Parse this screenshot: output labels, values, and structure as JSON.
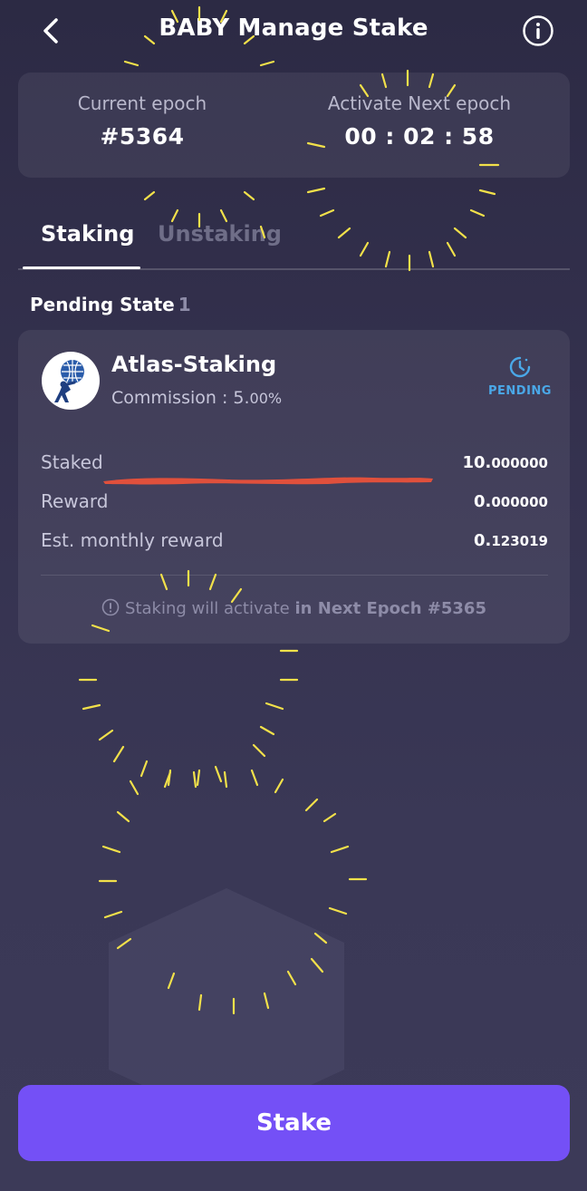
{
  "header": {
    "title": "BABY Manage Stake",
    "back_icon": "chevron-left-icon",
    "info_icon": "info-circle-icon"
  },
  "epoch": {
    "current_label": "Current epoch",
    "current_value": "#5364",
    "next_label": "Activate Next epoch",
    "next_value": "00 : 02 : 58"
  },
  "tabs": [
    {
      "label": "Staking",
      "active": true
    },
    {
      "label": "Unstaking",
      "active": false
    }
  ],
  "pending": {
    "label": "Pending State",
    "count": "1"
  },
  "validator": {
    "name": "Atlas-Staking",
    "commission_label": "Commission : 5.",
    "commission_pct": "00%",
    "status": "PENDING",
    "status_icon": "clock-icon",
    "rows": [
      {
        "label": "Staked",
        "int": "10.",
        "dec": "000000"
      },
      {
        "label": "Reward",
        "int": "0.",
        "dec": "000000"
      },
      {
        "label": "Est. monthly reward",
        "int": "0.",
        "dec": "123019"
      }
    ],
    "notice_prefix": "Staking will activate",
    "notice_strong": "in Next Epoch #5365"
  },
  "actions": {
    "stake_label": "Stake"
  },
  "colors": {
    "accent": "#7450f6",
    "pending": "#4aa8e8",
    "redaction": "#e0503c",
    "sparkle": "#f2e14a"
  }
}
